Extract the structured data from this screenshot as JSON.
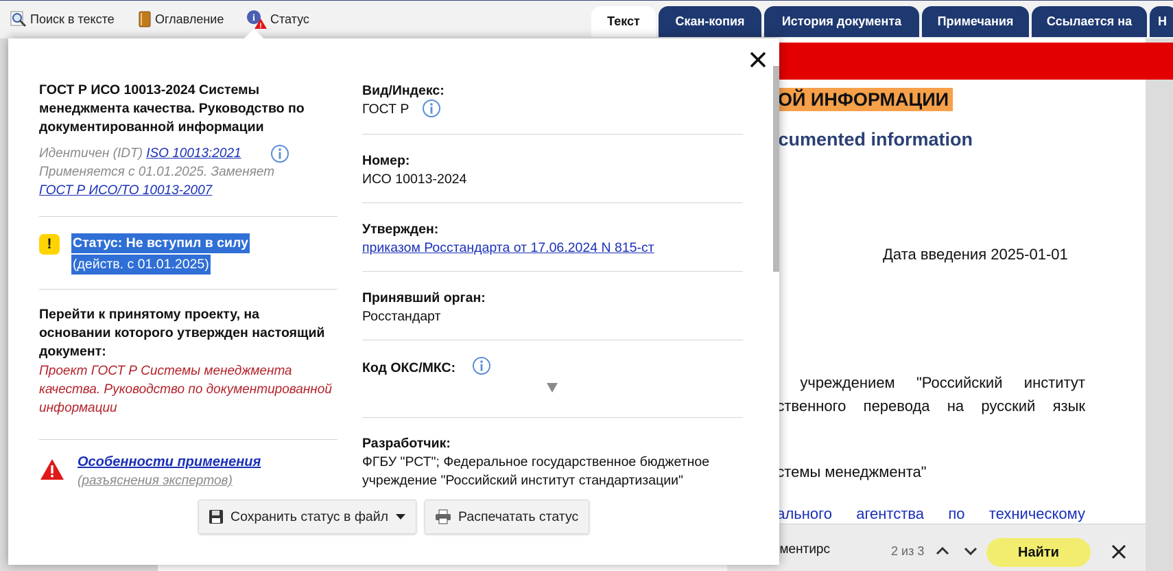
{
  "toolbar": {
    "search_label": "Поиск в тексте",
    "toc_label": "Оглавление",
    "status_label": "Статус"
  },
  "tabs": [
    {
      "label": "Текст",
      "active": true
    },
    {
      "label": "Скан-копия",
      "active": false
    },
    {
      "label": "История документа",
      "active": false
    },
    {
      "label": "Примечания",
      "active": false
    },
    {
      "label": "Ссылается на",
      "active": false
    },
    {
      "label": "Н",
      "active": false
    }
  ],
  "document": {
    "heading_fragment": "ОЙ ИНФОРМАЦИИ",
    "english_fragment": "ocumented information",
    "date_line": "Дата введения 2025-01-01",
    "line1": "м учреждением \"Российский институт",
    "line2": "бственного перевода на русский язык",
    "line3": "истемы менеджмента\"",
    "line4": "рального агентства по техническому"
  },
  "find": {
    "query": "гментирс",
    "count": "2 из 3",
    "button_label": "Найти"
  },
  "popup": {
    "doc_title": "ГОСТ Р ИСО 10013-2024 Системы менеджмента качества. Руководство по документированной информации",
    "identical_prefix": "Идентичен (IDT)",
    "identical_link": "ISO 10013:2021",
    "applies_text": "Применяется с 01.01.2025. Заменяет",
    "replaces_link": "ГОСТ Р ИСО/ТО 10013-2007",
    "status_badge": "!",
    "status_line1": "Статус: Не вступил в силу",
    "status_line2": "(действ. с 01.01.2025)",
    "project_heading": "Перейти к принятому проекту, на основании которого утвержден настоящий документ:",
    "project_link": "Проект ГОСТ Р Системы менеджмента качества. Руководство по документированной информации",
    "features_link": "Особенности применения",
    "features_sub": "(разъяснения экспертов)",
    "fields": {
      "kind_label": "Вид/Индекс:",
      "kind_value": "ГОСТ Р",
      "number_label": "Номер:",
      "number_value": "ИСО 10013-2024",
      "approved_label": "Утвержден:",
      "approved_value": "приказом Росстандарта от 17.06.2024 N 815-ст",
      "body_label": "Принявший орган:",
      "body_value": "Росстандарт",
      "oks_label": "Код ОКС/МКС:",
      "dev_label": "Разработчик:",
      "dev_value": "ФГБУ \"РСТ\"; Федеральное государственное бюджетное учреждение \"Российский институт стандартизации\""
    },
    "save_button": "Сохранить статус в файл",
    "print_button": "Распечатать статус"
  },
  "colors": {
    "tab_bg": "#1e3870",
    "red_bar": "#e30000",
    "heading_highlight": "#f6a04a",
    "selection": "#2f6fd6",
    "find_button": "#f2ed6e",
    "link": "#1a30b8",
    "project_link": "#b3222a"
  }
}
